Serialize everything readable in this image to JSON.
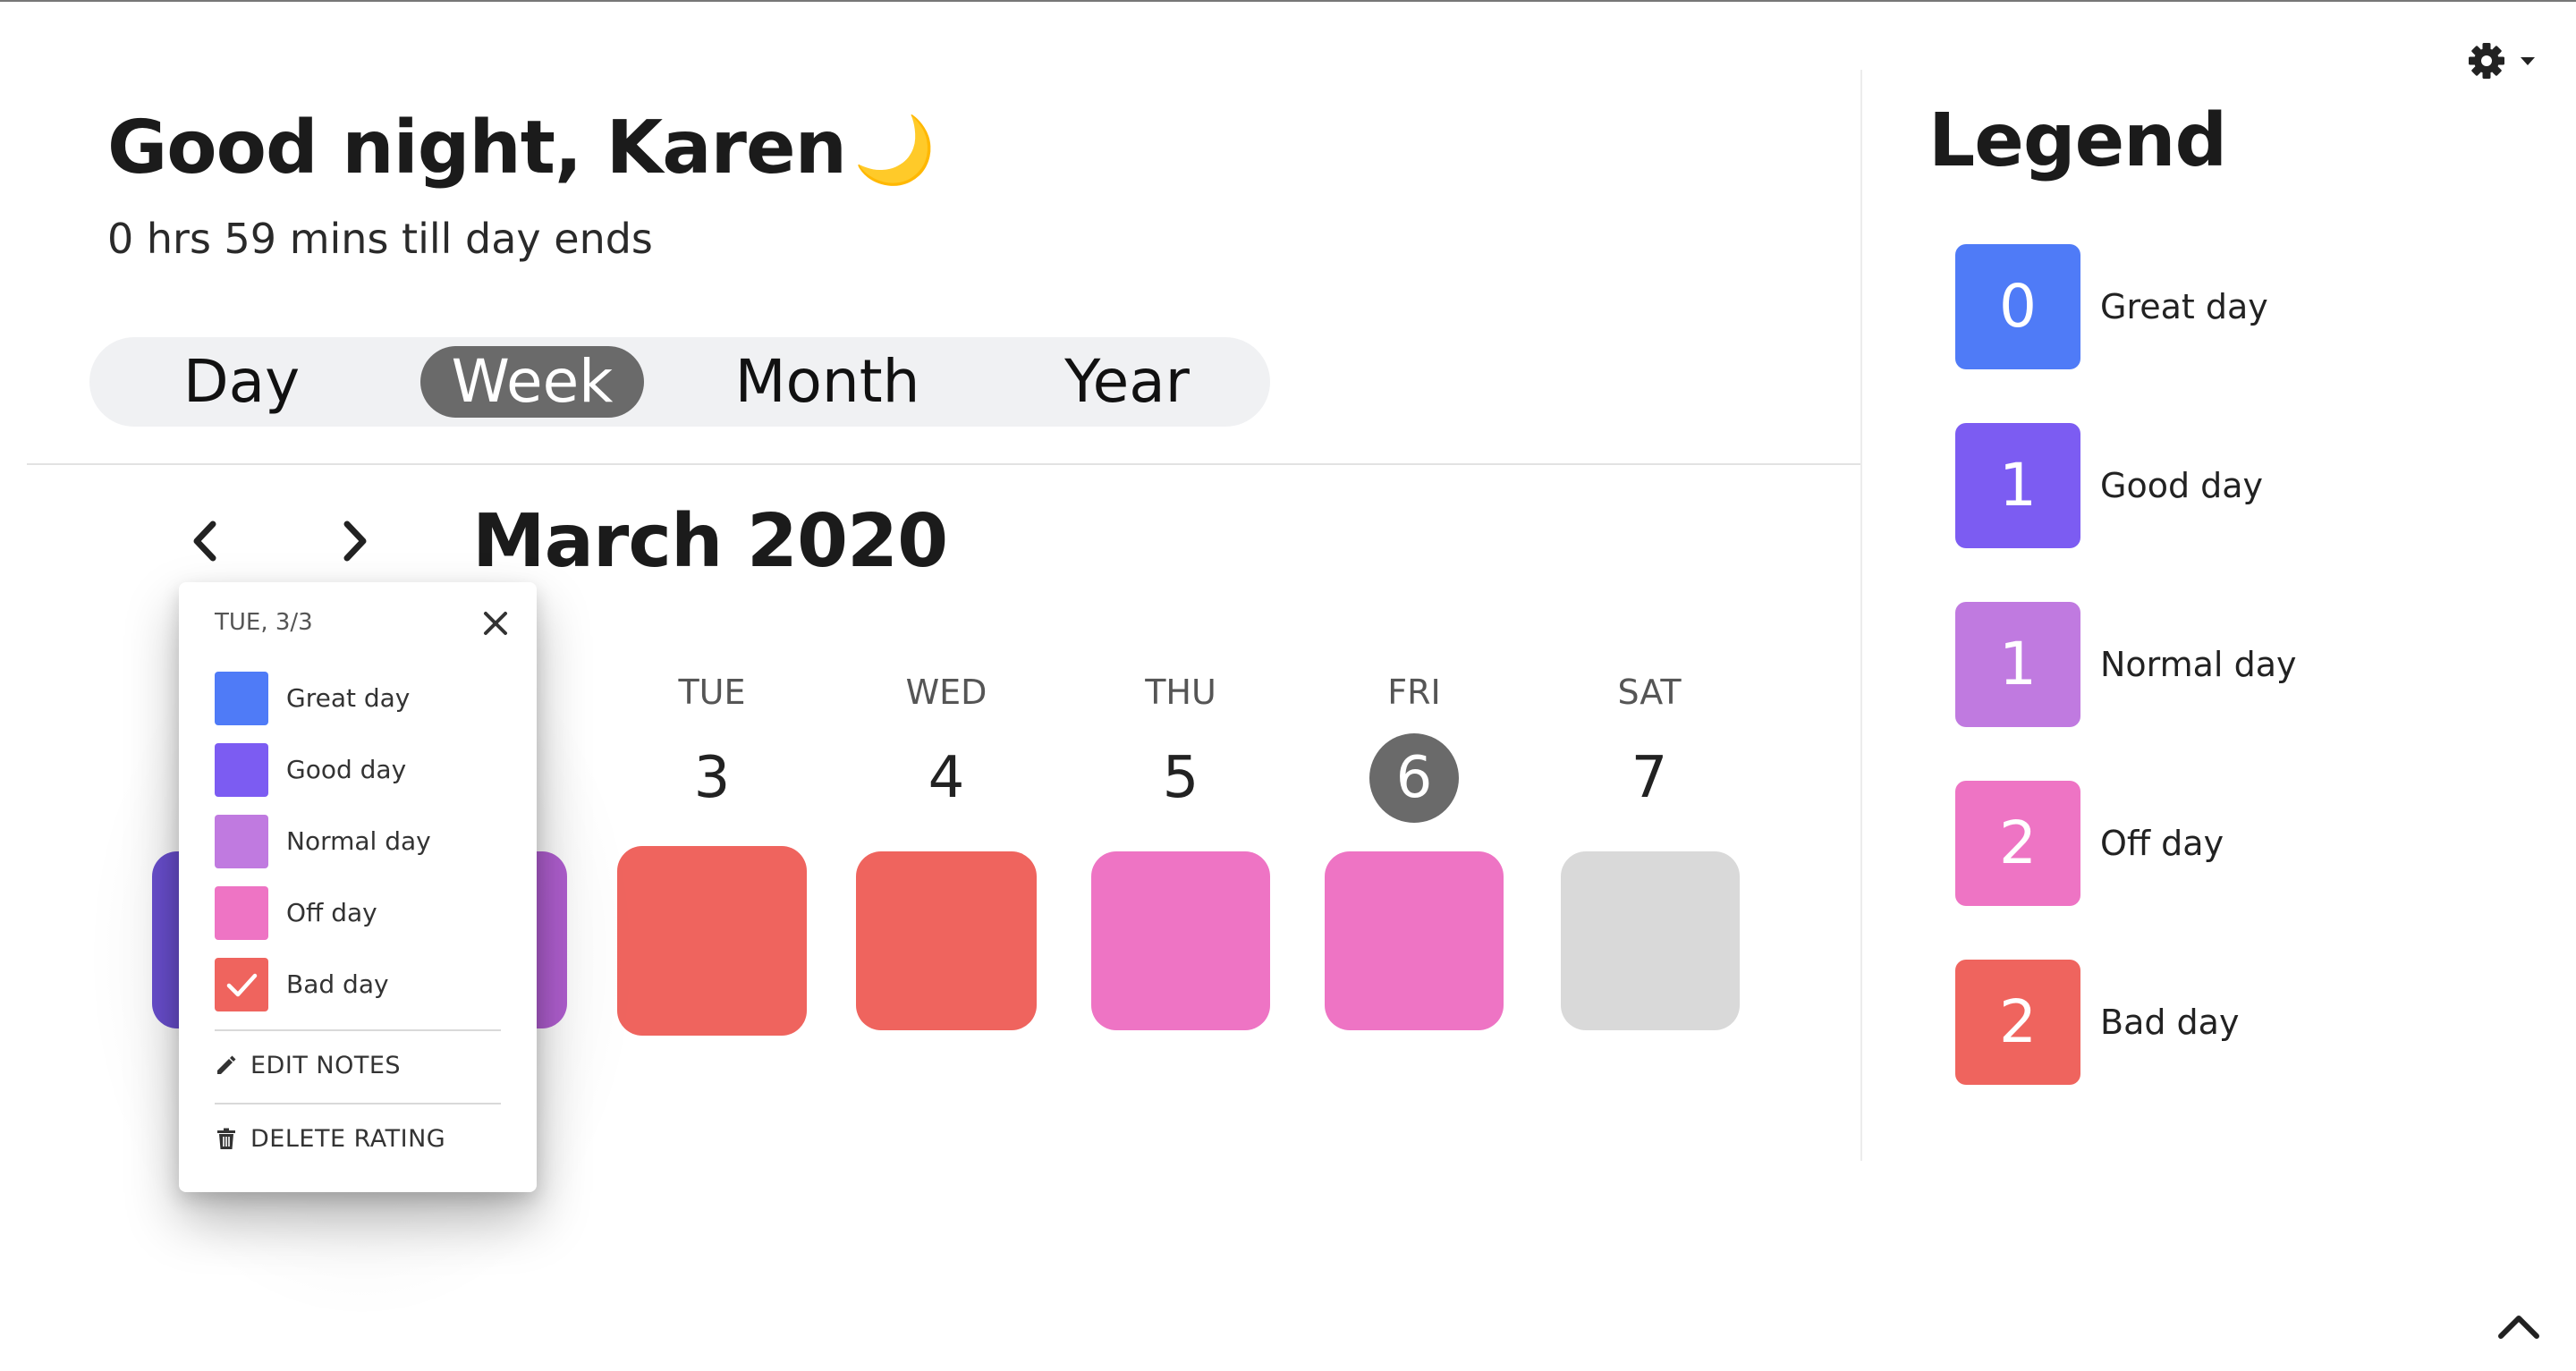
{
  "header": {
    "greeting": "Good night, Karen",
    "greeting_emoji": "🌙",
    "time_left": "0 hrs 59 mins till day ends"
  },
  "views": {
    "tabs": [
      "Day",
      "Week",
      "Month",
      "Year"
    ],
    "active": "Week"
  },
  "calendar": {
    "title": "March 2020",
    "prev_icon": "chevron-left-icon",
    "next_icon": "chevron-right-icon",
    "days": [
      {
        "dow": "TUE",
        "num": "3",
        "rating": "Bad day",
        "color": "#ef645e"
      },
      {
        "dow": "WED",
        "num": "4",
        "rating": "Bad day",
        "color": "#ef645e"
      },
      {
        "dow": "THU",
        "num": "5",
        "rating": "Off day",
        "color": "#ee74c4"
      },
      {
        "dow": "FRI",
        "num": "6",
        "rating": "Off day",
        "color": "#ee74c4",
        "today": true
      },
      {
        "dow": "SAT",
        "num": "7",
        "rating": "",
        "color": "#d9d9d9"
      }
    ],
    "hidden_day_colors": [
      "#6a4fd0",
      "#b15fd1"
    ]
  },
  "popup": {
    "date": "TUE, 3/3",
    "options": [
      {
        "label": "Great day",
        "color": "#4f7bf7"
      },
      {
        "label": "Good day",
        "color": "#7c5cf2"
      },
      {
        "label": "Normal day",
        "color": "#c07ae0"
      },
      {
        "label": "Off day",
        "color": "#ee74c4"
      },
      {
        "label": "Bad day",
        "color": "#ef645e",
        "selected": true
      }
    ],
    "edit_notes": "EDIT NOTES",
    "delete_rating": "DELETE RATING"
  },
  "legend": {
    "title": "Legend",
    "items": [
      {
        "count": "0",
        "label": "Great day",
        "color": "#4f7bf7"
      },
      {
        "count": "1",
        "label": "Good day",
        "color": "#7c5cf2"
      },
      {
        "count": "1",
        "label": "Normal day",
        "color": "#c07ae0"
      },
      {
        "count": "2",
        "label": "Off day",
        "color": "#ee74c4"
      },
      {
        "count": "2",
        "label": "Bad day",
        "color": "#ef645e"
      }
    ]
  },
  "icons": {
    "settings": "gear-icon",
    "scroll_top": "chevron-up-icon"
  }
}
